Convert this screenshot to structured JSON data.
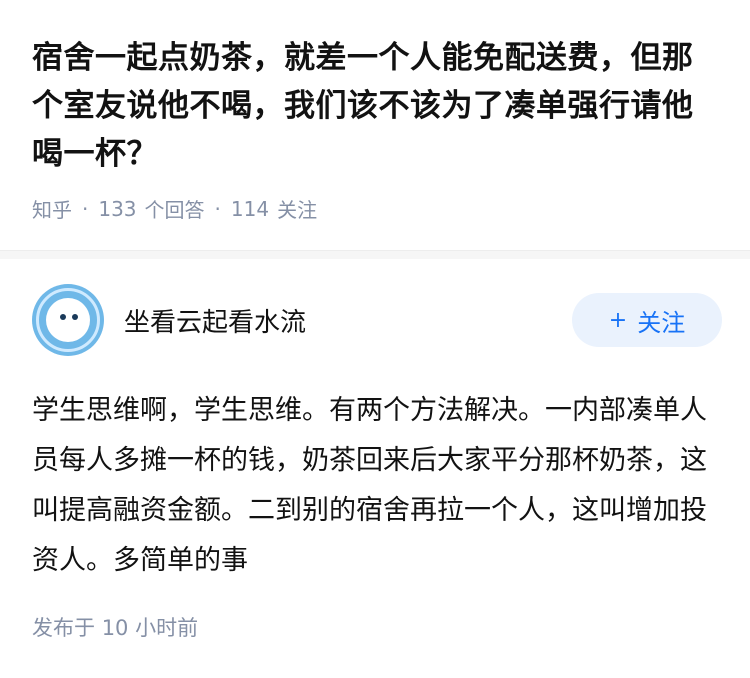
{
  "question": {
    "title": "宿舍一起点奶茶，就差一个人能免配送费，但那个室友说他不喝，我们该不该为了凑单强行请他喝一杯？",
    "source": "知乎",
    "answer_count": "133",
    "answer_label": "个回答",
    "follower_count": "114",
    "follower_label": "关注"
  },
  "answer": {
    "author_name": "坐看云起看水流",
    "follow_label": "关注",
    "follow_icon": "plus-icon",
    "content": "学生思维啊，学生思维。有两个方法解决。一内部凑单人员每人多摊一杯的钱，奶茶回来后大家平分那杯奶茶，这叫提高融资金额。二到别的宿舍再拉一个人，这叫增加投资人。多简单的事",
    "published_prefix": "发布于",
    "published_time": "10 小时前"
  },
  "colors": {
    "accent": "#1772f6",
    "follow_bg": "#eaf2fd",
    "meta_gray": "#8590a6",
    "avatar_blue": "#6fb8e8"
  }
}
